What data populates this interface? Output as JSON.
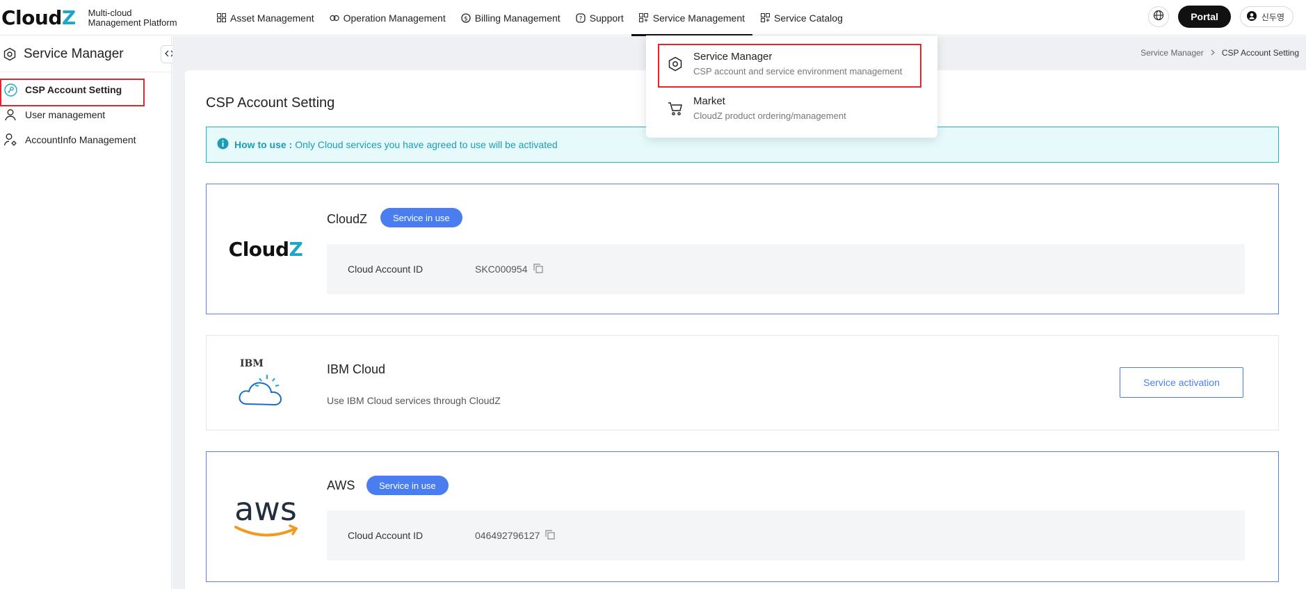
{
  "header": {
    "logo_text_main": "Cloud",
    "logo_text_accent": "Z",
    "logo_sub_line1": "Multi-cloud",
    "logo_sub_line2": "Management Platform",
    "nav": [
      {
        "label": "Asset Management",
        "icon": "grid-icon"
      },
      {
        "label": "Operation Management",
        "icon": "infinity-icon"
      },
      {
        "label": "Billing Management",
        "icon": "dollar-icon"
      },
      {
        "label": "Support",
        "icon": "question-icon"
      },
      {
        "label": "Service Management",
        "icon": "grid-plus-icon"
      },
      {
        "label": "Service Catalog",
        "icon": "grid-plus-icon"
      }
    ],
    "portal_label": "Portal",
    "user_name": "신두영"
  },
  "dropdown": {
    "items": [
      {
        "title": "Service Manager",
        "desc": "CSP account and service environment management",
        "icon": "hexagon-gear-icon"
      },
      {
        "title": "Market",
        "desc": "CloudZ product ordering/management",
        "icon": "cart-icon"
      }
    ]
  },
  "sidebar": {
    "title": "Service Manager",
    "items": [
      {
        "label": "CSP Account Setting",
        "icon": "key-icon",
        "active": true
      },
      {
        "label": "User management",
        "icon": "user-icon",
        "active": false
      },
      {
        "label": "AccountInfo Management",
        "icon": "user-gear-icon",
        "active": false
      }
    ]
  },
  "breadcrumb": {
    "parent": "Service Manager",
    "current": "CSP Account Setting"
  },
  "main": {
    "title": "CSP Account Setting",
    "info": {
      "label": "How to use :",
      "text": "Only Cloud services you have agreed to use will be activated"
    },
    "cards": [
      {
        "name": "CloudZ",
        "logo": "CloudZ",
        "badge": "Service in use",
        "account_label": "Cloud Account ID",
        "account_id": "SKC000954"
      },
      {
        "name": "IBM Cloud",
        "logo": "IBM",
        "desc": "Use IBM Cloud services through CloudZ",
        "button": "Service activation"
      },
      {
        "name": "AWS",
        "logo": "aws",
        "badge": "Service in use",
        "account_label": "Cloud Account ID",
        "account_id": "046492796127"
      }
    ]
  },
  "colors": {
    "accent": "#1aa7c9",
    "badge": "#4a7ef0",
    "highlight": "#e0262f"
  }
}
